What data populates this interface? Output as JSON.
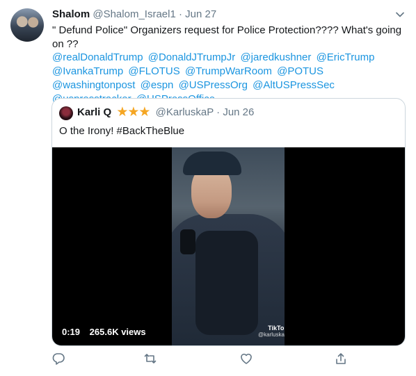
{
  "tweet": {
    "name": "Shalom",
    "handle": "@Shalom_Israel1",
    "separator": "·",
    "time": "Jun 27",
    "text": "\" Defund Police\" Organizers request for Police Protection???? What's going on ??",
    "mentions": [
      "@realDonaldTrump",
      "@DonaldJTrumpJr",
      "@jaredkushner",
      "@EricTrump",
      "@IvankaTrump",
      "@FLOTUS",
      "@TrumpWarRoom",
      "@POTUS",
      "@washingtonpost",
      "@espn",
      "@USPressOrg",
      "@AltUSPressSec",
      "@uspresstracker",
      "@USPressOffice"
    ]
  },
  "quote": {
    "name": "Karli Q",
    "stars": "★★★",
    "handle": "@KarluskaP",
    "separator": "·",
    "time": "Jun 26",
    "text": "O the Irony! #BackTheBlue",
    "video": {
      "duration": "0:19",
      "views": "265.6K views",
      "watermark": "TikTok",
      "watermark_handle": "@karluskap"
    }
  },
  "colors": {
    "link": "#1b95e0",
    "secondary": "#657786",
    "star": "#f5a623",
    "border": "#ccd6dd"
  },
  "icons": [
    "chevron-down-icon",
    "reply-icon",
    "retweet-icon",
    "like-icon",
    "share-icon"
  ]
}
